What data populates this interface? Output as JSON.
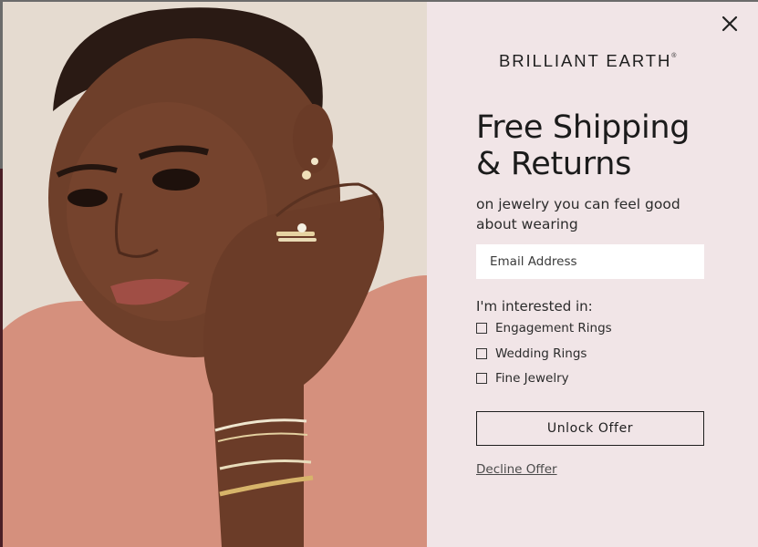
{
  "modal": {
    "brand": "BRILLIANT EARTH",
    "brand_mark": "®",
    "headline_line1": "Free Shipping",
    "headline_line2": "& Returns",
    "subhead_line1": "on jewelry you can feel good",
    "subhead_line2": "about wearing",
    "email": {
      "placeholder": "Email Address",
      "value": ""
    },
    "interest_label": "I'm interested in:",
    "interests": [
      {
        "label": "Engagement Rings",
        "checked": false
      },
      {
        "label": "Wedding Rings",
        "checked": false
      },
      {
        "label": "Fine Jewelry",
        "checked": false
      }
    ],
    "cta_label": "Unlock Offer",
    "decline_label": "Decline Offer",
    "close_icon": "close-icon"
  },
  "colors": {
    "panel_background": "#f1e5e7",
    "text": "#1e1e1e",
    "sweater": "#d58f7c",
    "skin": "#6e3f2a"
  }
}
